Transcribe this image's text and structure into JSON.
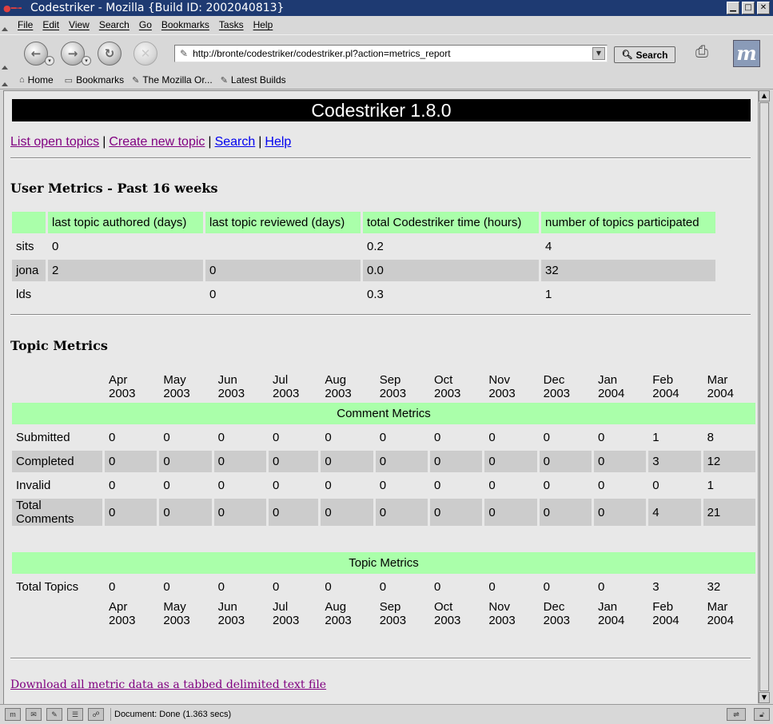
{
  "window": {
    "title": "Codestriker - Mozilla {Build ID: 2002040813}",
    "buttons": [
      "▁",
      "□",
      "✕"
    ]
  },
  "menu": [
    "File",
    "Edit",
    "View",
    "Search",
    "Go",
    "Bookmarks",
    "Tasks",
    "Help"
  ],
  "nav": {
    "url": "http://bronte/codestriker/codestriker.pl?action=metrics_report",
    "search_label": "Search"
  },
  "personal_toolbar": {
    "home": "Home",
    "bookmarks": "Bookmarks",
    "mozilla": "The Mozilla Or...",
    "latest": "Latest Builds"
  },
  "page": {
    "banner": "Codestriker 1.8.0",
    "links": {
      "list_open_topics": "List open topics",
      "create_new_topic": "Create new topic",
      "search": "Search",
      "help": "Help",
      "sep": "|"
    },
    "user_metrics_heading": "User Metrics - Past 16 weeks",
    "user_metrics": {
      "headers": [
        "",
        "last topic authored (days)",
        "last topic reviewed (days)",
        "total Codestriker time (hours)",
        "number of topics participated"
      ],
      "rows": [
        [
          "sits",
          "0",
          "",
          "0.2",
          "4"
        ],
        [
          "jona",
          "2",
          "0",
          "0.0",
          "32"
        ],
        [
          "lds",
          "",
          "0",
          "0.3",
          "1"
        ]
      ]
    },
    "topic_metrics_heading": "Topic Metrics",
    "topic_metrics": {
      "months": [
        [
          "Apr",
          "2003"
        ],
        [
          "May",
          "2003"
        ],
        [
          "Jun",
          "2003"
        ],
        [
          "Jul",
          "2003"
        ],
        [
          "Aug",
          "2003"
        ],
        [
          "Sep",
          "2003"
        ],
        [
          "Oct",
          "2003"
        ],
        [
          "Nov",
          "2003"
        ],
        [
          "Dec",
          "2003"
        ],
        [
          "Jan",
          "2004"
        ],
        [
          "Feb",
          "2004"
        ],
        [
          "Mar",
          "2004"
        ]
      ],
      "comment_group": "Comment Metrics",
      "comment_rows": [
        {
          "label": "Submitted",
          "values": [
            "0",
            "0",
            "0",
            "0",
            "0",
            "0",
            "0",
            "0",
            "0",
            "0",
            "1",
            "8"
          ]
        },
        {
          "label": "Completed",
          "values": [
            "0",
            "0",
            "0",
            "0",
            "0",
            "0",
            "0",
            "0",
            "0",
            "0",
            "3",
            "12"
          ]
        },
        {
          "label": "Invalid",
          "values": [
            "0",
            "0",
            "0",
            "0",
            "0",
            "0",
            "0",
            "0",
            "0",
            "0",
            "0",
            "1"
          ]
        },
        {
          "label": "Total Comments",
          "values": [
            "0",
            "0",
            "0",
            "0",
            "0",
            "0",
            "0",
            "0",
            "0",
            "0",
            "4",
            "21"
          ]
        }
      ],
      "topic_group": "Topic Metrics",
      "topic_rows": [
        {
          "label": "Total Topics",
          "values": [
            "0",
            "0",
            "0",
            "0",
            "0",
            "0",
            "0",
            "0",
            "0",
            "0",
            "3",
            "32"
          ]
        }
      ]
    },
    "download_link": "Download all metric data as a tabbed delimited text file"
  },
  "status": {
    "text": "Document: Done (1.363 secs)"
  }
}
